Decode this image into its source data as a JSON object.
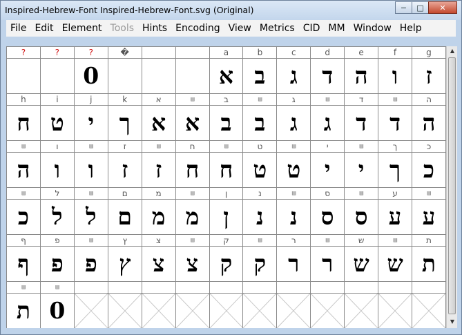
{
  "window": {
    "title": "Inspired-Hebrew-Font  Inspired-Hebrew-Font.svg (Original)"
  },
  "window_buttons": {
    "minimize": "−",
    "maximize": "□",
    "close": "✕"
  },
  "menu": [
    "File",
    "Edit",
    "Element",
    "Tools",
    "Hints",
    "Encoding",
    "View",
    "Metrics",
    "CID",
    "MM",
    "Window",
    "Help"
  ],
  "menu_disabled": [
    "Tools"
  ],
  "rows": [
    {
      "labels": [
        "?",
        "?",
        "?",
        "�",
        "",
        "",
        "a",
        "b",
        "c",
        "d",
        "e",
        "f",
        "g"
      ],
      "glyphs": [
        "",
        "",
        "0",
        "",
        "",
        "",
        "א",
        "ב",
        "ג",
        "ד",
        "ה",
        "ו",
        "ז"
      ]
    },
    {
      "labels": [
        "h",
        "i",
        "j",
        "k",
        "א",
        "▤",
        "ב",
        "▤",
        "ג",
        "▤",
        "ד",
        "▤",
        "ה"
      ],
      "glyphs": [
        "ח",
        "ט",
        "י",
        "ך",
        "א",
        "א",
        "ב",
        "ב",
        "ג",
        "ג",
        "ד",
        "ד",
        "ה"
      ]
    },
    {
      "labels": [
        "▤",
        "ו",
        "▤",
        "ז",
        "▤",
        "ח",
        "▤",
        "ט",
        "▤",
        "י",
        "▤",
        "ך",
        "כ"
      ],
      "glyphs": [
        "ה",
        "ו",
        "ו",
        "ז",
        "ז",
        "ח",
        "ח",
        "ט",
        "ט",
        "י",
        "י",
        "ך",
        "כ"
      ]
    },
    {
      "labels": [
        "▤",
        "ל",
        "▤",
        "ם",
        "מ",
        "▤",
        "ן",
        "נ",
        "▤",
        "ס",
        "▤",
        "ע",
        "▤"
      ],
      "glyphs": [
        "כ",
        "ל",
        "ל",
        "ם",
        "מ",
        "מ",
        "ן",
        "נ",
        "נ",
        "ס",
        "ס",
        "ע",
        "ע"
      ]
    },
    {
      "labels": [
        "ף",
        "פ",
        "▤",
        "ץ",
        "צ",
        "▤",
        "ק",
        "▤",
        "ר",
        "▤",
        "ש",
        "▤",
        "ת"
      ],
      "glyphs": [
        "ף",
        "פ",
        "פ",
        "ץ",
        "צ",
        "צ",
        "ק",
        "ק",
        "ר",
        "ר",
        "ש",
        "ש",
        "ת"
      ]
    },
    {
      "labels": [
        "▤",
        "▤",
        "",
        "",
        "",
        "",
        "",
        "",
        "",
        "",
        "",
        "",
        ""
      ],
      "glyphs": [
        "ת",
        "0",
        "#x",
        "#x",
        "#x",
        "#x",
        "#x",
        "#x",
        "#x",
        "#x",
        "#x",
        "#x",
        "#x"
      ]
    }
  ]
}
